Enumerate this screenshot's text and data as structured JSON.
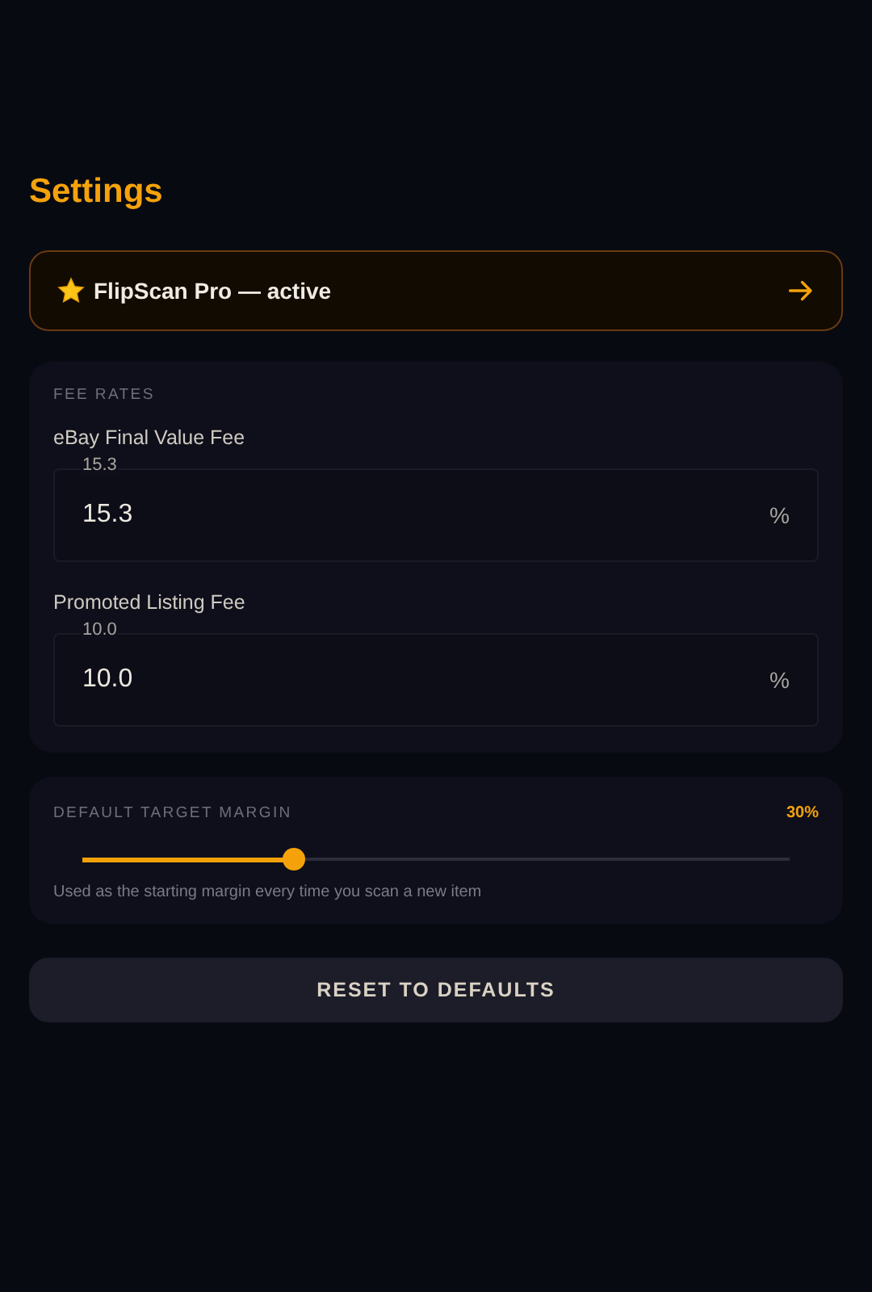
{
  "title": "Settings",
  "pro_banner": {
    "text": "FlipScan Pro — active"
  },
  "fee_rates": {
    "heading": "FEE RATES",
    "fields": [
      {
        "label": "eBay Final Value Fee",
        "floating_label": "15.3",
        "value": "15.3",
        "suffix": "%"
      },
      {
        "label": "Promoted Listing Fee",
        "floating_label": "10.0",
        "value": "10.0",
        "suffix": "%"
      }
    ]
  },
  "target_margin": {
    "heading": "DEFAULT TARGET MARGIN",
    "reading": "30%",
    "level": 0.3,
    "hint": "Used as the starting margin every time you scan a new item"
  },
  "reset_button": "RESET TO DEFAULTS"
}
